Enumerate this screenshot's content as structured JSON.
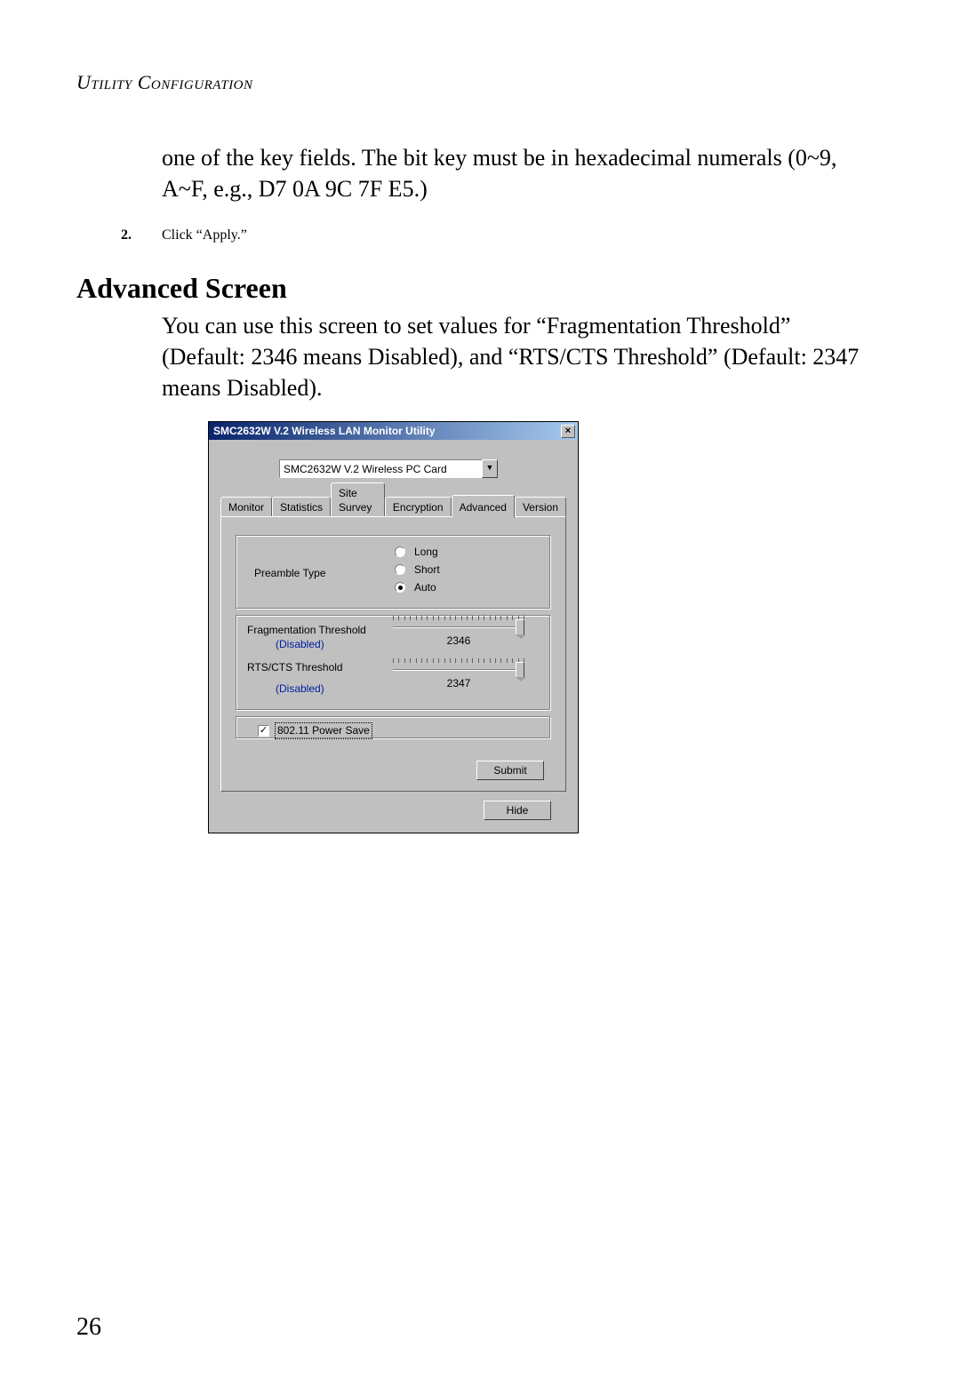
{
  "running_head": "Utility Configuration",
  "para1": "one of the key fields. The bit key must be in hexadecimal numerals (0~9, A~F, e.g., D7 0A 9C 7F E5.)",
  "step_num": "2.",
  "step_text": "Click “Apply.”",
  "heading": "Advanced Screen",
  "para2": "You can use this screen to set values for “Fragmentation Threshold” (Default: 2346 means Disabled), and “RTS/CTS Threshold” (Default: 2347 means Disabled).",
  "page_number": "26",
  "dialog": {
    "title": "SMC2632W V.2 Wireless LAN Monitor Utility",
    "combo_value": "SMC2632W V.2 Wireless PC Card",
    "tabs": [
      "Monitor",
      "Statistics",
      "Site Survey",
      "Encryption",
      "Advanced",
      "Version"
    ],
    "active_tab_index": 4,
    "preamble_label": "Preamble Type",
    "preamble_options": [
      "Long",
      "Short",
      "Auto"
    ],
    "preamble_selected_index": 2,
    "frag_label": "Fragmentation Threshold",
    "disabled_text": "(Disabled)",
    "rts_label": "RTS/CTS Threshold",
    "frag_value": "2346",
    "rts_value": "2347",
    "power_save_label": "802.11 Power Save",
    "power_save_checked": true,
    "submit_label": "Submit",
    "hide_label": "Hide"
  }
}
